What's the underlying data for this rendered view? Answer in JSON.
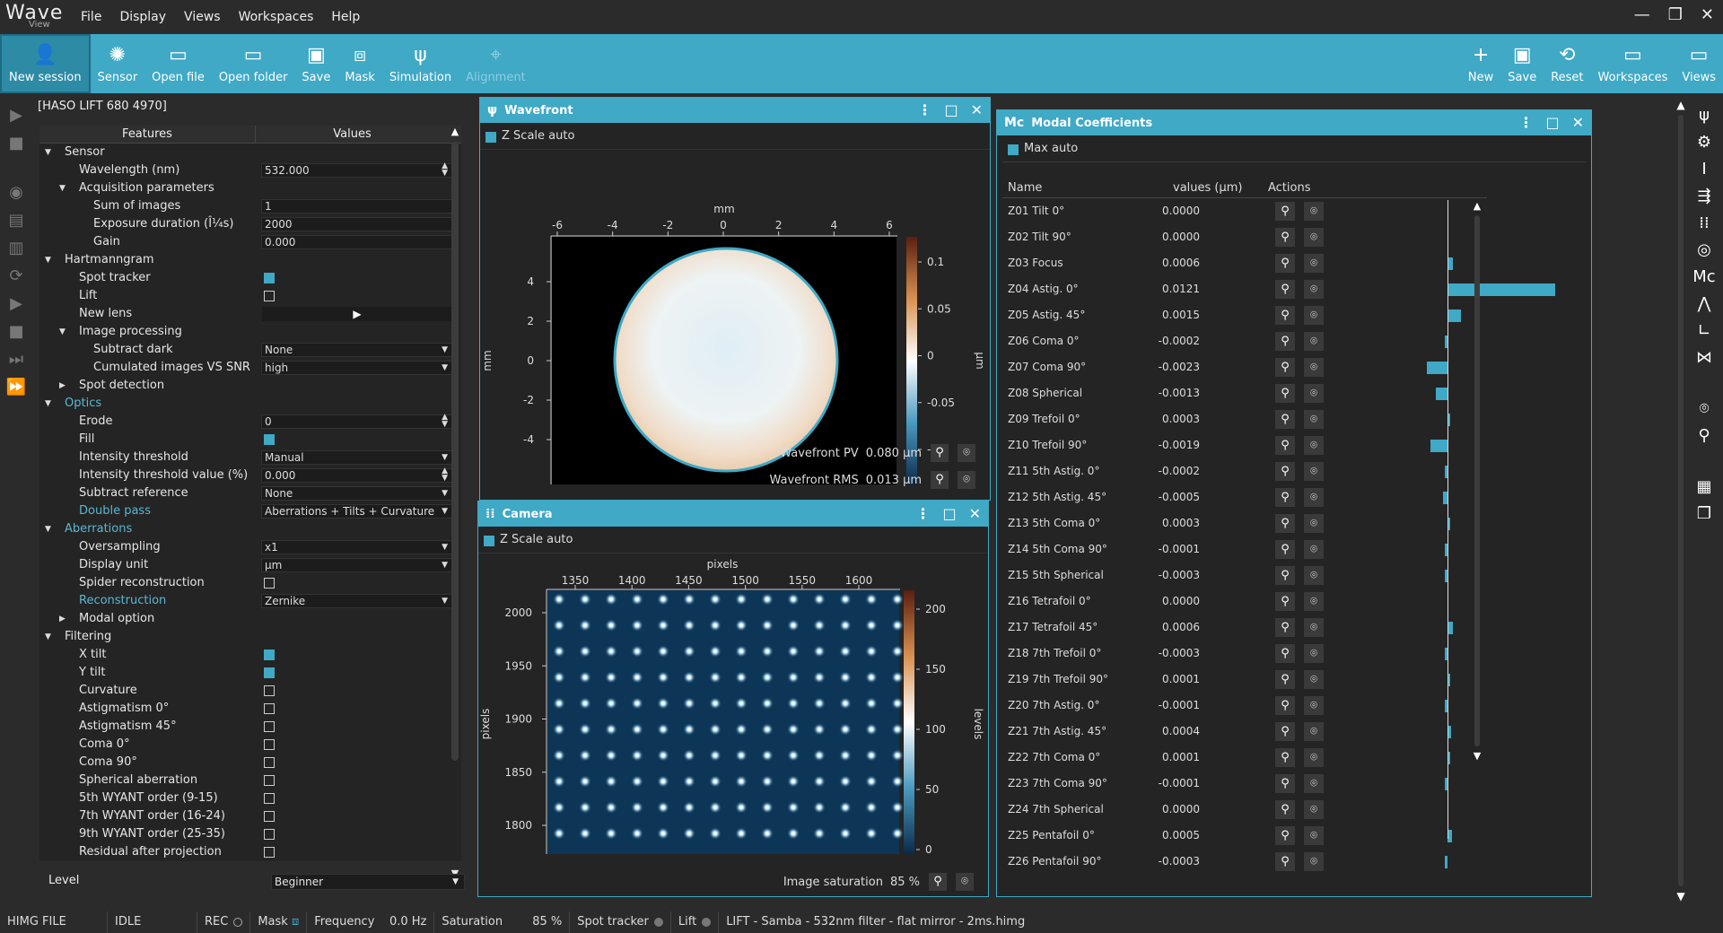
{
  "app": {
    "logo_main": "Wave",
    "logo_sub": "View"
  },
  "menu": [
    "File",
    "Display",
    "Views",
    "Workspaces",
    "Help"
  ],
  "window_controls": [
    "—",
    "❐",
    "✕"
  ],
  "toolbar": {
    "left": [
      {
        "label": "New session",
        "icon": "new-session-icon"
      },
      {
        "label": "Sensor",
        "icon": "sensor-icon"
      },
      {
        "label": "Open file",
        "icon": "open-file-icon"
      },
      {
        "label": "Open folder",
        "icon": "open-folder-icon"
      },
      {
        "label": "Save",
        "icon": "save-icon"
      },
      {
        "label": "Mask",
        "icon": "mask-icon"
      },
      {
        "label": "Simulation",
        "icon": "simulation-icon"
      },
      {
        "label": "Alignment",
        "icon": "alignment-icon",
        "disabled": true
      }
    ],
    "right": [
      {
        "label": "New",
        "icon": "new-workspace-icon"
      },
      {
        "label": "Save",
        "icon": "save-workspace-icon"
      },
      {
        "label": "Reset",
        "icon": "reset-icon"
      },
      {
        "label": "Workspaces",
        "icon": "workspaces-icon"
      },
      {
        "label": "Views",
        "icon": "views-icon"
      }
    ]
  },
  "features": {
    "device": "[HASO LIFT 680 4970]",
    "col_features": "Features",
    "col_values": "Values",
    "rows": [
      {
        "level": 0,
        "label": "Sensor",
        "arrow": "down"
      },
      {
        "level": 1,
        "label": "Wavelength (nm)",
        "value": "532.000",
        "ctrl": "spin"
      },
      {
        "level": 1,
        "label": "Acquisition parameters",
        "arrow": "down"
      },
      {
        "level": 2,
        "label": "Sum of images",
        "value": "1",
        "ctrl": "text"
      },
      {
        "level": 2,
        "label": "Exposure duration (Î¼s)",
        "value": "2000",
        "ctrl": "text"
      },
      {
        "level": 2,
        "label": "Gain",
        "value": "0.000",
        "ctrl": "text"
      },
      {
        "level": 0,
        "label": "Hartmanngram",
        "arrow": "down"
      },
      {
        "level": 1,
        "label": "Spot tracker",
        "ctrl": "check",
        "checked": true
      },
      {
        "level": 1,
        "label": "Lift",
        "ctrl": "check",
        "checked": false
      },
      {
        "level": 1,
        "label": "New lens",
        "ctrl": "play",
        "value": "▶"
      },
      {
        "level": 1,
        "label": "Image processing",
        "arrow": "down"
      },
      {
        "level": 2,
        "label": "Subtract dark",
        "value": "None",
        "ctrl": "drop"
      },
      {
        "level": 2,
        "label": "Cumulated images VS SNR",
        "value": "high",
        "ctrl": "drop"
      },
      {
        "level": 1,
        "label": "Spot detection",
        "arrow": "right"
      },
      {
        "level": 0,
        "label": "Optics",
        "arrow": "down",
        "highlight": true
      },
      {
        "level": 1,
        "label": "Erode",
        "value": "0",
        "ctrl": "spin"
      },
      {
        "level": 1,
        "label": "Fill",
        "ctrl": "check",
        "checked": true
      },
      {
        "level": 1,
        "label": "Intensity threshold",
        "value": "Manual",
        "ctrl": "drop"
      },
      {
        "level": 1,
        "label": "Intensity threshold value (%)",
        "value": "0.000",
        "ctrl": "spin"
      },
      {
        "level": 1,
        "label": "Subtract reference",
        "value": "None",
        "ctrl": "drop"
      },
      {
        "level": 1,
        "label": "Double pass",
        "value": "Aberrations + Tilts + Curvature",
        "ctrl": "drop",
        "highlight": true
      },
      {
        "level": 0,
        "label": "Aberrations",
        "arrow": "down",
        "highlight": true
      },
      {
        "level": 1,
        "label": "Oversampling",
        "value": "x1",
        "ctrl": "drop"
      },
      {
        "level": 1,
        "label": "Display unit",
        "value": "µm",
        "ctrl": "drop"
      },
      {
        "level": 1,
        "label": "Spider reconstruction",
        "ctrl": "check",
        "checked": false
      },
      {
        "level": 1,
        "label": "Reconstruction",
        "value": "Zernike",
        "ctrl": "drop",
        "highlight": true
      },
      {
        "level": 1,
        "label": "Modal option",
        "arrow": "right"
      },
      {
        "level": 0,
        "label": "Filtering",
        "arrow": "down"
      },
      {
        "level": 1,
        "label": "X tilt",
        "ctrl": "check",
        "checked": true
      },
      {
        "level": 1,
        "label": "Y tilt",
        "ctrl": "check",
        "checked": true
      },
      {
        "level": 1,
        "label": "Curvature",
        "ctrl": "check",
        "checked": false
      },
      {
        "level": 1,
        "label": "Astigmatism 0°",
        "ctrl": "check",
        "checked": false
      },
      {
        "level": 1,
        "label": "Astigmatism 45°",
        "ctrl": "check",
        "checked": false
      },
      {
        "level": 1,
        "label": "Coma 0°",
        "ctrl": "check",
        "checked": false
      },
      {
        "level": 1,
        "label": "Coma 90°",
        "ctrl": "check",
        "checked": false
      },
      {
        "level": 1,
        "label": "Spherical aberration",
        "ctrl": "check",
        "checked": false
      },
      {
        "level": 1,
        "label": "5th WYANT order (9-15)",
        "ctrl": "check",
        "checked": false
      },
      {
        "level": 1,
        "label": "7th WYANT order (16-24)",
        "ctrl": "check",
        "checked": false
      },
      {
        "level": 1,
        "label": "9th WYANT order (25-35)",
        "ctrl": "check",
        "checked": false
      },
      {
        "level": 1,
        "label": "Residual after projection",
        "ctrl": "check",
        "checked": false
      }
    ],
    "level_label": "Level",
    "level_value": "Beginner"
  },
  "wavefront": {
    "title": "Wavefront",
    "zscale": "Z Scale auto",
    "xlabel": "mm",
    "ylabel": "mm",
    "xticks": [
      "-6",
      "-4",
      "-2",
      "0",
      "2",
      "4",
      "6"
    ],
    "yticks": [
      "4",
      "2",
      "0",
      "-2",
      "-4"
    ],
    "cbar_label": "µm",
    "cbar_ticks": [
      "0.1",
      "0.05",
      "0",
      "-0.05",
      "-0.1"
    ],
    "pv_label": "Wavefront PV",
    "pv_value": "0.080",
    "pv_unit": "µm",
    "rms_label": "Wavefront RMS",
    "rms_value": "0.013",
    "rms_unit": "µm"
  },
  "camera": {
    "title": "Camera",
    "zscale": "Z Scale auto",
    "xlabel": "pixels",
    "ylabel": "pixels",
    "xticks": [
      "1350",
      "1400",
      "1450",
      "1500",
      "1550",
      "1600"
    ],
    "yticks": [
      "2000",
      "1950",
      "1900",
      "1850",
      "1800"
    ],
    "cbar_label": "levels",
    "cbar_ticks": [
      "200",
      "150",
      "100",
      "50",
      "0"
    ],
    "sat_label": "Image saturation",
    "sat_value": "85",
    "sat_unit": "%"
  },
  "modal": {
    "title": "Modal Coefficients",
    "max_auto": "Max auto",
    "col_name": "Name",
    "col_values": "values (µm)",
    "col_actions": "Actions",
    "rows": [
      {
        "name": "Z01 Tilt 0°",
        "value": "0.0000",
        "v": 0.0
      },
      {
        "name": "Z02 Tilt 90°",
        "value": "0.0000",
        "v": 0.0
      },
      {
        "name": "Z03 Focus",
        "value": "0.0006",
        "v": 0.0006
      },
      {
        "name": "Z04 Astig. 0°",
        "value": "0.0121",
        "v": 0.0121
      },
      {
        "name": "Z05 Astig. 45°",
        "value": "0.0015",
        "v": 0.0015
      },
      {
        "name": "Z06 Coma 0°",
        "value": "-0.0002",
        "v": -0.0002
      },
      {
        "name": "Z07 Coma 90°",
        "value": "-0.0023",
        "v": -0.0023
      },
      {
        "name": "Z08 Spherical",
        "value": "-0.0013",
        "v": -0.0013
      },
      {
        "name": "Z09 Trefoil 0°",
        "value": "0.0003",
        "v": 0.0003
      },
      {
        "name": "Z10 Trefoil 90°",
        "value": "-0.0019",
        "v": -0.0019
      },
      {
        "name": "Z11 5th Astig. 0°",
        "value": "-0.0002",
        "v": -0.0002
      },
      {
        "name": "Z12 5th Astig. 45°",
        "value": "-0.0005",
        "v": -0.0005
      },
      {
        "name": "Z13 5th Coma 0°",
        "value": "0.0003",
        "v": 0.0003
      },
      {
        "name": "Z14 5th Coma 90°",
        "value": "-0.0001",
        "v": -0.0001
      },
      {
        "name": "Z15 5th Spherical",
        "value": "-0.0003",
        "v": -0.0003
      },
      {
        "name": "Z16 Tetrafoil 0°",
        "value": "0.0000",
        "v": 0.0
      },
      {
        "name": "Z17 Tetrafoil 45°",
        "value": "0.0006",
        "v": 0.0006
      },
      {
        "name": "Z18 7th Trefoil 0°",
        "value": "-0.0003",
        "v": -0.0003
      },
      {
        "name": "Z19 7th Trefoil 90°",
        "value": "0.0001",
        "v": 0.0001
      },
      {
        "name": "Z20 7th Astig. 0°",
        "value": "-0.0001",
        "v": -0.0001
      },
      {
        "name": "Z21 7th Astig. 45°",
        "value": "0.0004",
        "v": 0.0004
      },
      {
        "name": "Z22 7th Coma 0°",
        "value": "0.0001",
        "v": 0.0001
      },
      {
        "name": "Z23 7th Coma 90°",
        "value": "-0.0001",
        "v": -0.0001
      },
      {
        "name": "Z24 7th Spherical",
        "value": "0.0000",
        "v": 0.0
      },
      {
        "name": "Z25 Pentafoil 0°",
        "value": "0.0005",
        "v": 0.0005
      },
      {
        "name": "Z26 Pentafoil 90°",
        "value": "-0.0003",
        "v": -0.0003
      }
    ]
  },
  "status": {
    "file": "HIMG FILE",
    "state": "IDLE",
    "rec": "REC",
    "mask": "Mask",
    "freq_label": "Frequency",
    "freq_value": "0.0 Hz",
    "sat_label": "Saturation",
    "sat_value": "85 %",
    "spot_label": "Spot tracker",
    "lift_label": "Lift",
    "filename": "LIFT - Samba - 532nm filter - flat mirror - 2ms.himg"
  },
  "colors": {
    "accent": "#3fa9c6",
    "bg": "#2b2b2b",
    "panel": "#242424"
  }
}
